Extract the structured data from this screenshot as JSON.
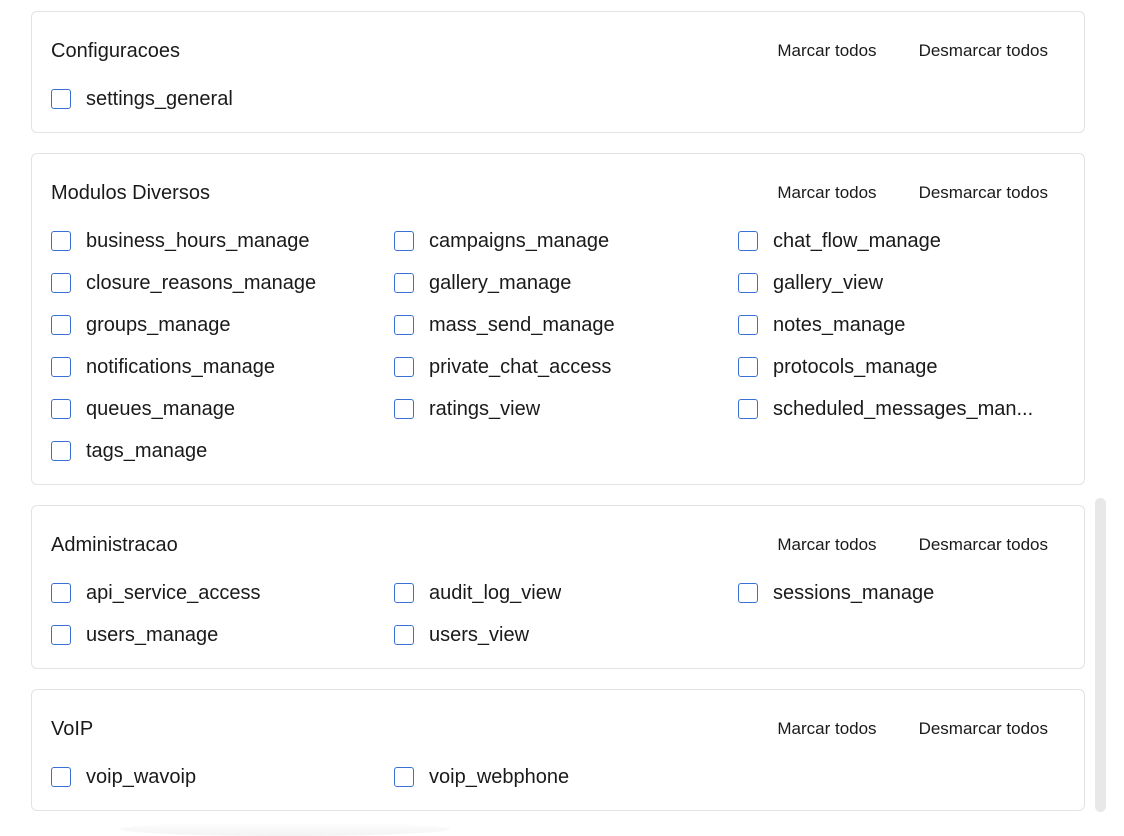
{
  "actions": {
    "select_all": "Marcar todos",
    "deselect_all": "Desmarcar todos"
  },
  "groups": [
    {
      "title": "Configuracoes",
      "items": [
        "settings_general"
      ]
    },
    {
      "title": "Modulos Diversos",
      "items": [
        "business_hours_manage",
        "campaigns_manage",
        "chat_flow_manage",
        "closure_reasons_manage",
        "gallery_manage",
        "gallery_view",
        "groups_manage",
        "mass_send_manage",
        "notes_manage",
        "notifications_manage",
        "private_chat_access",
        "protocols_manage",
        "queues_manage",
        "ratings_view",
        "scheduled_messages_man...",
        "tags_manage"
      ]
    },
    {
      "title": "Administracao",
      "items": [
        "api_service_access",
        "audit_log_view",
        "sessions_manage",
        "users_manage",
        "users_view"
      ]
    },
    {
      "title": "VoIP",
      "items": [
        "voip_wavoip",
        "voip_webphone"
      ]
    }
  ],
  "colors": {
    "checkbox_border": "#3a6fd4",
    "card_border": "#e3e3e3"
  }
}
